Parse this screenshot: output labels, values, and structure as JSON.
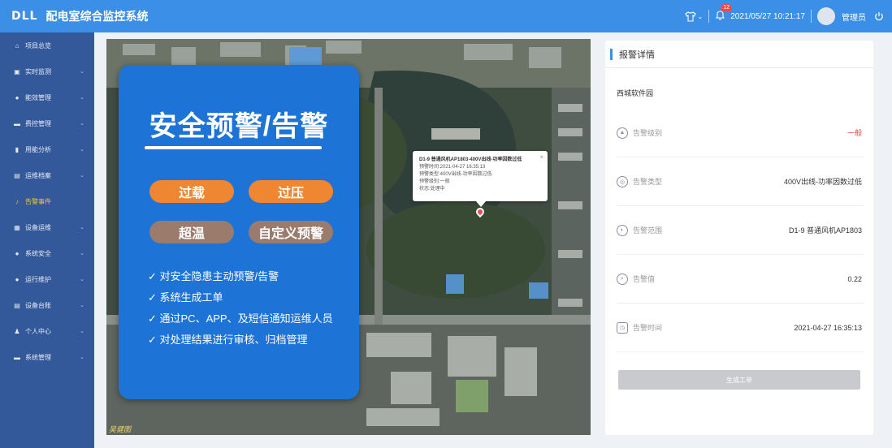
{
  "header": {
    "logo": "DLL",
    "title": "配电室综合监控系统",
    "notification_count": "12",
    "datetime": "2021/05/27 10:21:17",
    "user": "管理员"
  },
  "sidebar": {
    "items": [
      {
        "label": "项目总览",
        "icon": "home-icon",
        "has_chevron": false
      },
      {
        "label": "实时监测",
        "icon": "monitor-icon",
        "has_chevron": true
      },
      {
        "label": "能效管理",
        "icon": "energy-icon",
        "has_chevron": true
      },
      {
        "label": "费控管理",
        "icon": "fee-icon",
        "has_chevron": true
      },
      {
        "label": "用能分析",
        "icon": "bar-chart-icon",
        "has_chevron": true
      },
      {
        "label": "运维档案",
        "icon": "archive-icon",
        "has_chevron": true
      },
      {
        "label": "告警事件",
        "icon": "bell-icon",
        "has_chevron": false,
        "active": true
      },
      {
        "label": "设备运维",
        "icon": "device-icon",
        "has_chevron": true
      },
      {
        "label": "系统安全",
        "icon": "shield-icon",
        "has_chevron": true
      },
      {
        "label": "运行维护",
        "icon": "location-icon",
        "has_chevron": true
      },
      {
        "label": "设备台账",
        "icon": "ledger-icon",
        "has_chevron": true
      },
      {
        "label": "个人中心",
        "icon": "user-icon",
        "has_chevron": true
      },
      {
        "label": "系统管理",
        "icon": "screen-icon",
        "has_chevron": true
      }
    ],
    "active_color": "#f5c242"
  },
  "promo": {
    "title": "安全预警/告警",
    "tags": [
      "过载",
      "过压",
      "超温",
      "自定义预警"
    ],
    "features": [
      "✓ 对安全隐患主动预警/告警",
      "✓ 系统生成工单",
      "✓ 通过PC、APP、及短信通知运维人员",
      "✓ 对处理结果进行审核、归档管理"
    ]
  },
  "popup": {
    "title": "D1-9 普通风机AP1803-400V出线-功率因数过低",
    "lines": [
      "预警时间:2021-04-27 16:35:13",
      "预警类型:400V出线-功率因数过低",
      "预警级别:一般",
      "状态:处理中"
    ],
    "close": "×"
  },
  "map": {
    "watermark": "吴健图"
  },
  "detail": {
    "title": "报警详情",
    "location": "西城软件园",
    "rows": [
      {
        "label": "告警级别",
        "value": "一般",
        "icon": "level-icon",
        "highlight": true
      },
      {
        "label": "告警类型",
        "value": "400V出线-功率因数过低",
        "icon": "type-icon"
      },
      {
        "label": "告警范围",
        "value": "D1-9 普通风机AP1803",
        "icon": "range-icon"
      },
      {
        "label": "告警值",
        "value": "0.22",
        "icon": "value-icon"
      },
      {
        "label": "告警时间",
        "value": "2021-04-27 16:35:13",
        "icon": "time-icon"
      }
    ],
    "button": "生成工单"
  }
}
